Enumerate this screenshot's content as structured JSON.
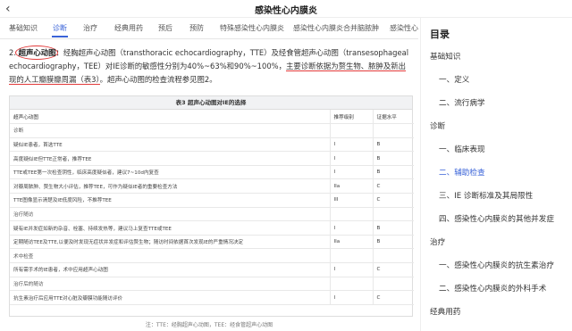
{
  "app": {
    "title": "感染性心内膜炎",
    "back_icon": "chevron-left-icon"
  },
  "tabs": [
    {
      "label": "基础知识"
    },
    {
      "label": "诊断"
    },
    {
      "label": "治疗"
    },
    {
      "label": "经典用药"
    },
    {
      "label": "预后"
    },
    {
      "label": "预防"
    },
    {
      "label": "特殊感染性心内膜炎"
    },
    {
      "label": "感染性心内膜炎合并脑脓肿"
    },
    {
      "label": "感染性心"
    }
  ],
  "content": {
    "para_prefix": "2. ",
    "para_title": "超声心动图",
    "para_mid1": "：经胸超声心动图（transthoracic echocardiography，TTE）及经食管超声心动图（transesophageal echocardiography，TEE）对IE诊断的敏感性分别为40%~63%和90%~100%，",
    "para_highlight": "主要诊断依据为赘生物、脓肿及新出现的人工瓣膜瓣周漏（表3）",
    "para_suffix": "。超声心动图的检查流程参见图2。",
    "table_caption": "表3 超声心动图对IE的选择",
    "table_headers": [
      "超声心动图",
      "推荐级别",
      "证据水平"
    ],
    "table_rows": [
      {
        "cells": [
          "诊断",
          "",
          ""
        ],
        "section": true
      },
      {
        "cells": [
          "疑似IE患者，首选TTE",
          "I",
          "B"
        ]
      },
      {
        "cells": [
          "高度疑似IE但TTE正常者，推荐TEE",
          "I",
          "B"
        ]
      },
      {
        "cells": [
          "TTE或TEE第一次检查阴性，临床高度疑似者，建议7~10d内复查",
          "I",
          "B"
        ]
      },
      {
        "cells": [
          "对瓣周脓肿、赘生物大小评估，推荐TEE，可作为疑似IE者的重要检查方法",
          "IIa",
          "C"
        ]
      },
      {
        "cells": [
          "TTE图像显示清楚及IE低度风险，不推荐TEE",
          "III",
          "C"
        ]
      },
      {
        "cells": [
          "治疗随访",
          "",
          ""
        ],
        "section": true
      },
      {
        "cells": [
          "疑有IE并发症如新的杂音、栓塞、持续发热等，建议马上复查TTE或TEE",
          "I",
          "B"
        ]
      },
      {
        "cells": [
          "定期随访TEE及TTE,以便及时发现无症状并发症和评估赘生物；随访时间依据首次发现IE的严重情况决定",
          "IIa",
          "B"
        ]
      },
      {
        "cells": [
          "术中检查",
          "",
          ""
        ],
        "section": true
      },
      {
        "cells": [
          "所有需手术的IE患者，术中应用超声心动图",
          "I",
          "C"
        ]
      },
      {
        "cells": [
          "治疗后的随访",
          "",
          ""
        ],
        "section": true
      },
      {
        "cells": [
          "抗生素治疗后应用TTE对心脏及瓣膜功能随访评价",
          "I",
          "C"
        ]
      }
    ],
    "table_note": "注：TTE：经胸超声心动图，TEE：经食管超声心动图"
  },
  "toc": {
    "title": "目录",
    "items": [
      {
        "label": "基础知识",
        "level": 1
      },
      {
        "label": "一、定义",
        "level": 2
      },
      {
        "label": "二、流行病学",
        "level": 2
      },
      {
        "label": "诊断",
        "level": 1
      },
      {
        "label": "一、临床表现",
        "level": 2
      },
      {
        "label": "二、辅助检查",
        "level": 2,
        "active": true
      },
      {
        "label": "三、IE 诊断标准及其局限性",
        "level": 2
      },
      {
        "label": "四、感染性心内膜炎的其他并发症",
        "level": 2
      },
      {
        "label": "治疗",
        "level": 1
      },
      {
        "label": "一、感染性心内膜炎的抗生素治疗",
        "level": 2
      },
      {
        "label": "二、感染性心内膜炎的外科手术",
        "level": 2
      },
      {
        "label": "经典用药",
        "level": 1
      }
    ]
  },
  "colors": {
    "accent": "#3a63d8",
    "annotation": "#e23b3b"
  }
}
